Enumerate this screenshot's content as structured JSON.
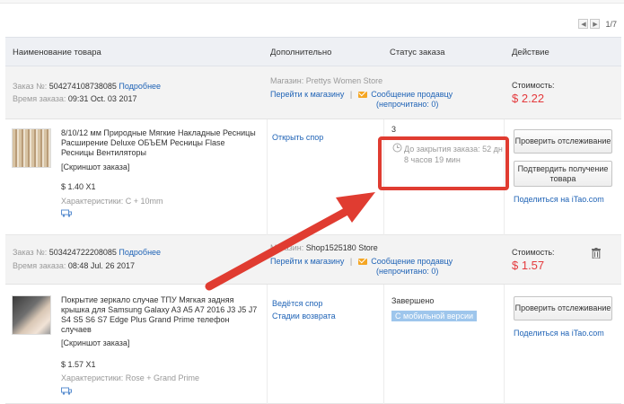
{
  "pager": {
    "prev": "◀",
    "next": "▶",
    "page": "1/7"
  },
  "columns": {
    "product": "Наименование товара",
    "extra": "Дополнительно",
    "status": "Статус заказа",
    "action": "Действие"
  },
  "order1": {
    "order_label": "Заказ №:",
    "order_no": "504274108738085",
    "details": "Подробнее",
    "time_label": "Время заказа:",
    "time": "09:31 Oct. 03 2017",
    "store_label": "Магазин:",
    "store": "Prettys Women Store",
    "go_store": "Перейти к магазину",
    "separator": "|",
    "message_seller": "Сообщение продавцу",
    "unread": "(непрочитано: 0)",
    "cost_label": "Стоимость:",
    "cost": "$ 2.22",
    "product_title": "8/10/12 мм Природные Мягкие Накладные Ресницы Расширение Deluxe ОБЪЕМ Ресницы Flase Ресницы Вентиляторы",
    "snapshot": "[Скриншот заказа]",
    "price_qty": "$ 1.40 X1",
    "specs": "Характеристики: C + 10mm",
    "open_dispute": "Открыть спор",
    "status_top": "3",
    "timer_text": "До закрытия заказа: 52 дн 8 часов 19 мин",
    "btn_track": "Проверить отслеживание",
    "btn_confirm": "Подтвердить получение товара",
    "share_label": "Поделиться на",
    "share_site": "iTao.com"
  },
  "order2": {
    "order_label": "Заказ №:",
    "order_no": "503424722208085",
    "details": "Подробнее",
    "time_label": "Время заказа:",
    "time": "08:48 Jul. 26 2017",
    "store_label": "Магазин:",
    "store": "Shop1525180 Store",
    "go_store": "Перейти к магазину",
    "separator": "|",
    "message_seller": "Сообщение продавцу",
    "unread": "(непрочитано: 0)",
    "cost_label": "Стоимость:",
    "cost": "$ 1.57",
    "product_title": "Покрытие зеркало случае ТПУ Мягкая задняя крышка для Samsung Galaxy A3 A5 A7 2016 J3 J5 J7 S4 S5 S6 S7 Edge Plus Grand Prime телефон случаев",
    "snapshot": "[Скриншот заказа]",
    "price_qty": "$ 1.57 X1",
    "specs": "Характеристики: Rose + Grand Prime",
    "dispute_running": "Ведётся спор",
    "return_stages": "Стадии возврата",
    "status": "Завершено",
    "mobile_badge": "С мобильной версии",
    "btn_track": "Проверить отслеживание",
    "share_label": "Поделиться на",
    "share_site": "iTao.com"
  },
  "colors": {
    "accent_red": "#e03c31",
    "link": "#1f63b6",
    "price": "#e4393c"
  }
}
